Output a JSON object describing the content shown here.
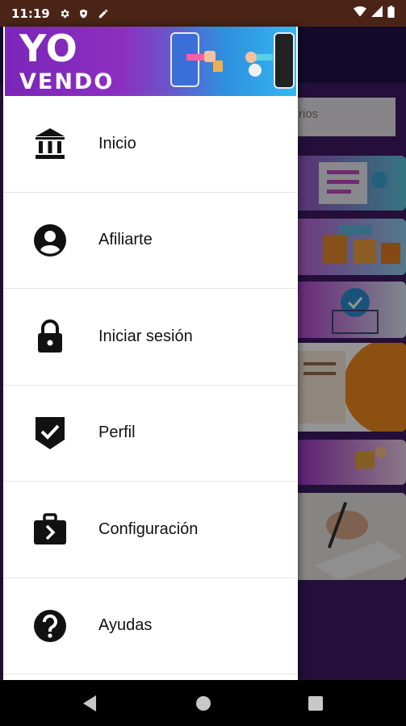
{
  "status_bar": {
    "time": "11:19",
    "icons": [
      "gear-icon",
      "shield-icon",
      "pen-icon"
    ],
    "right_icons": [
      "wifi-icon",
      "signal-icon",
      "battery-icon"
    ]
  },
  "background_app": {
    "search_placeholder": "rios"
  },
  "drawer": {
    "banner": {
      "line1": "YO",
      "line2": "VENDO"
    },
    "items": [
      {
        "label": "Inicio",
        "icon": "bank-icon"
      },
      {
        "label": "Afiliarte",
        "icon": "account-circle-icon"
      },
      {
        "label": "Iniciar sesión",
        "icon": "lock-icon"
      },
      {
        "label": "Perfil",
        "icon": "shield-check-icon"
      },
      {
        "label": "Configuración",
        "icon": "briefcase-arrow-icon"
      },
      {
        "label": "Ayudas",
        "icon": "help-circle-icon"
      }
    ]
  },
  "navigation_bar": {
    "buttons": [
      "back-icon",
      "home-icon",
      "recents-icon"
    ]
  },
  "colors": {
    "status_bar": "#4a2416",
    "drawer_bg": "#ffffff",
    "banner_purple": "#8c2fc0",
    "banner_blue": "#33b8ef",
    "background_purple": "#3d1a63"
  }
}
